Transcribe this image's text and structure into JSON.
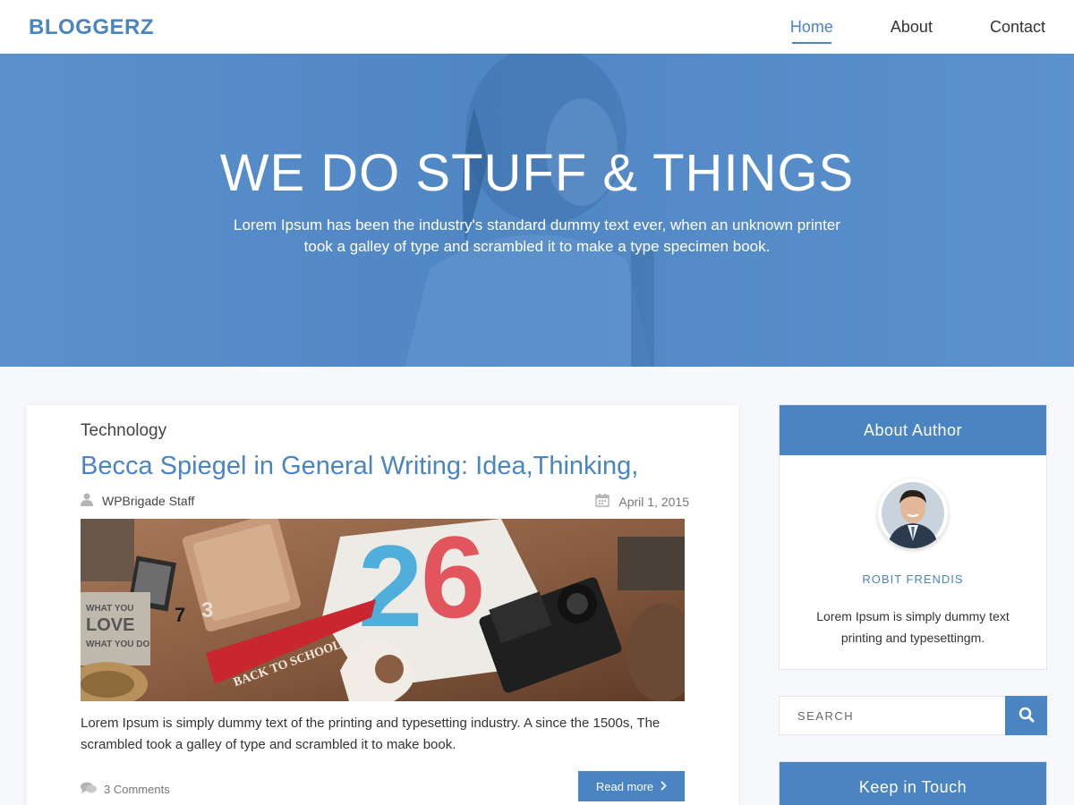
{
  "header": {
    "logo": "BLOGGERZ",
    "nav": [
      {
        "label": "Home",
        "active": true
      },
      {
        "label": "About",
        "active": false
      },
      {
        "label": "Contact",
        "active": false
      }
    ]
  },
  "hero": {
    "title": "WE DO STUFF & THINGS",
    "subtitle": "Lorem Ipsum has been the industry's standard dummy text ever, when an unknown printer took a galley of type and scrambled it to make a type specimen book."
  },
  "post": {
    "category": "Technology",
    "title": "Becca Spiegel in General Writing: Idea,Thinking,",
    "author": "WPBrigade Staff",
    "date": "April 1, 2015",
    "excerpt": "Lorem Ipsum is simply dummy text of the printing and typesetting industry. A since the 1500s, The scrambled  took a galley of type and scrambled it to make book.",
    "comments": "3 Comments",
    "read_more": "Read more",
    "image_texts": {
      "pennant": "BACK TO SCHOOL",
      "notebook": "WHAT YOU LOVE WHAT YOU DO",
      "shirt": "26"
    }
  },
  "sidebar": {
    "about": {
      "heading": "About Author",
      "name": "ROBIT FRENDIS",
      "bio": "Lorem Ipsum is simply dummy text printing and typesettingm."
    },
    "search": {
      "placeholder": "SEARCH"
    },
    "touch": {
      "heading": "Keep in Touch"
    }
  },
  "colors": {
    "accent": "#4a84c2",
    "background": "#f7f8fc"
  }
}
